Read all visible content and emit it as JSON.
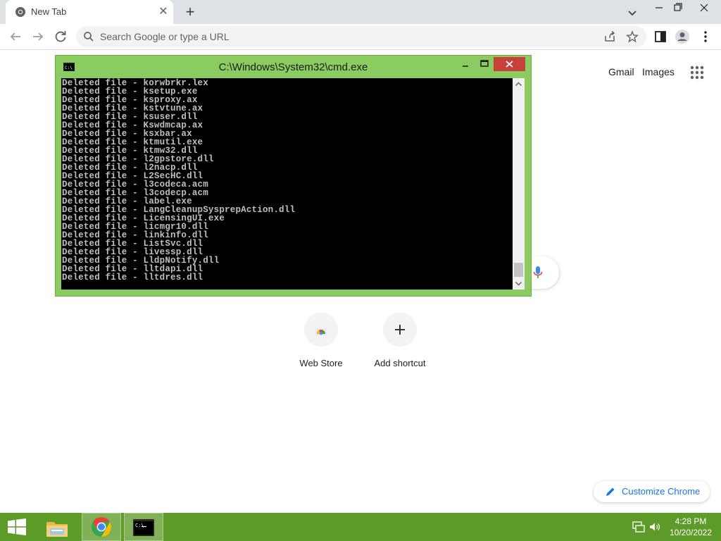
{
  "browser": {
    "tab_title": "New Tab",
    "omnibox_placeholder": "Search Google or type a URL"
  },
  "ntp": {
    "gmail_label": "Gmail",
    "images_label": "Images",
    "shortcuts": [
      {
        "label": "Web Store",
        "icon": "web-store-icon"
      },
      {
        "label": "Add shortcut",
        "icon": "plus-icon"
      }
    ],
    "customize_label": "Customize Chrome"
  },
  "cmd": {
    "title": "C:\\Windows\\System32\\cmd.exe",
    "lines": [
      "Deleted file - korwbrkr.lex",
      "Deleted file - ksetup.exe",
      "Deleted file - ksproxy.ax",
      "Deleted file - kstvtune.ax",
      "Deleted file - ksuser.dll",
      "Deleted file - Kswdmcap.ax",
      "Deleted file - ksxbar.ax",
      "Deleted file - ktmutil.exe",
      "Deleted file - ktmw32.dll",
      "Deleted file - l2gpstore.dll",
      "Deleted file - l2nacp.dll",
      "Deleted file - L2SecHC.dll",
      "Deleted file - l3codeca.acm",
      "Deleted file - l3codecp.acm",
      "Deleted file - label.exe",
      "Deleted file - LangCleanupSysprepAction.dll",
      "Deleted file - LicensingUI.exe",
      "Deleted file - licmgr10.dll",
      "Deleted file - linkinfo.dll",
      "Deleted file - ListSvc.dll",
      "Deleted file - livessp.dll",
      "Deleted file - LldpNotify.dll",
      "Deleted file - lltdapi.dll",
      "Deleted file - lltdres.dll"
    ]
  },
  "taskbar": {
    "time": "4:28 PM",
    "date": "10/20/2022"
  },
  "colors": {
    "taskbar": "#5d9b28",
    "cmd_frame": "#8bcc60",
    "cmd_close": "#c7403a",
    "link_blue": "#1a73e8"
  }
}
